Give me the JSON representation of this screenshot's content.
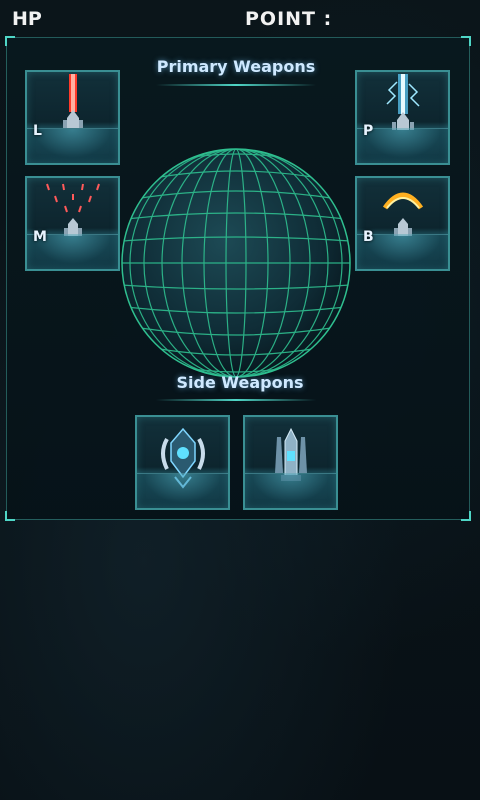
{
  "hud": {
    "hp_label": "HP",
    "point_label": "POINT :"
  },
  "panel": {
    "primary_title": "Primary Weapons",
    "side_title": "Side Weapons",
    "primary_slots": [
      {
        "id": "laser",
        "letter": "L",
        "beam_color": "#ff3a2a",
        "icon": "laser-ship-icon"
      },
      {
        "id": "plasma",
        "letter": "P",
        "beam_color": "#7fe3ff",
        "icon": "plasma-ship-icon"
      },
      {
        "id": "missile",
        "letter": "M",
        "beam_color": "#ff5a5a",
        "icon": "missile-ship-icon"
      },
      {
        "id": "boomerang",
        "letter": "B",
        "beam_color": "#ffb020",
        "icon": "boomerang-ship-icon"
      }
    ],
    "side_slots": [
      {
        "id": "side-a",
        "icon": "side-weapon-drone-icon"
      },
      {
        "id": "side-b",
        "icon": "side-weapon-ship-icon"
      }
    ]
  },
  "colors": {
    "accent": "#4fd6c6",
    "globe_grid": "#2fbf8f",
    "slot_border": "#3a8f93"
  }
}
